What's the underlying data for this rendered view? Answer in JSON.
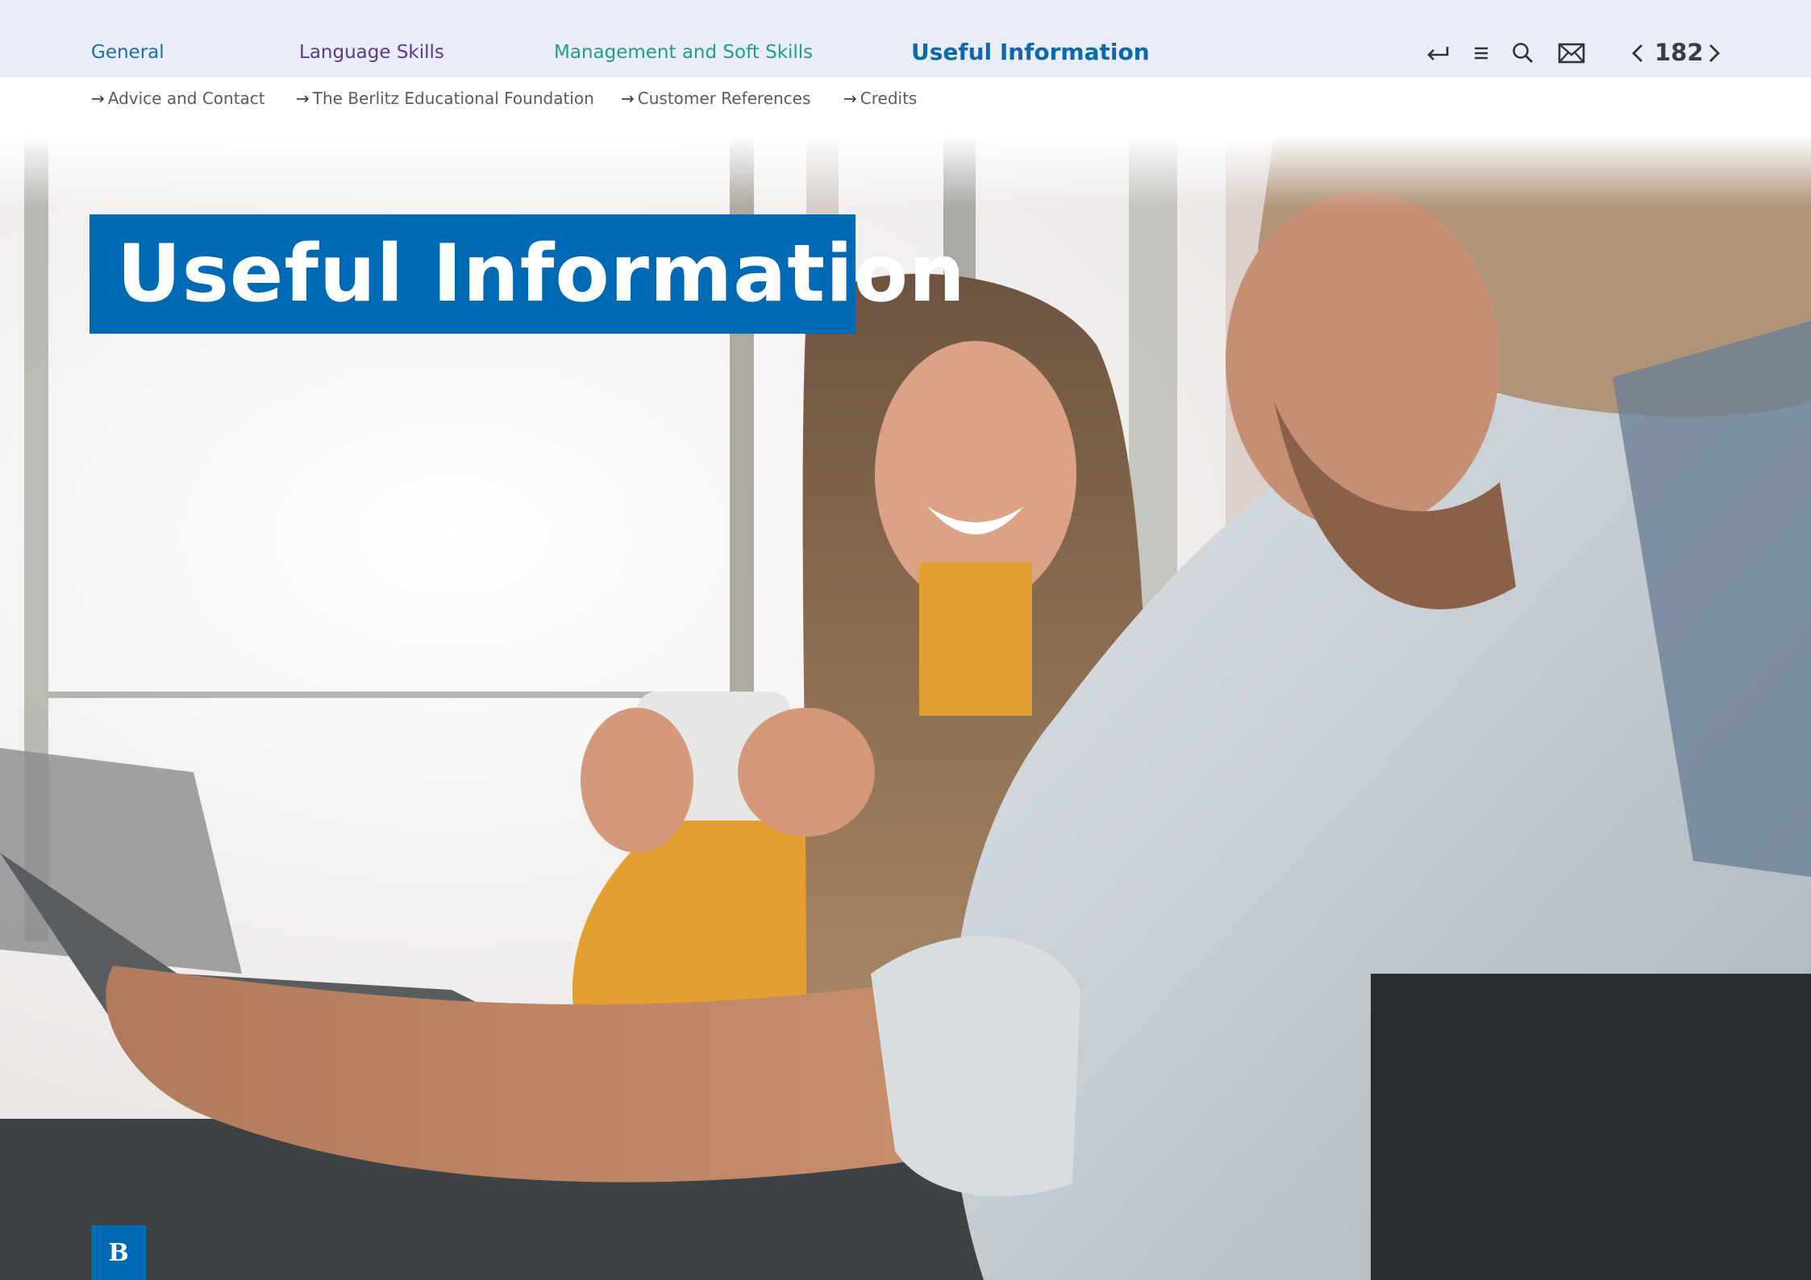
{
  "nav": {
    "tabs": [
      {
        "label": "General",
        "color": "#1a6ea8"
      },
      {
        "label": "Language Skills",
        "color": "#5b3a8c"
      },
      {
        "label": "Management and Soft Skills",
        "color": "#1f9e82"
      },
      {
        "label": "Useful Information",
        "color": "#0a68ad"
      }
    ],
    "active_tab": "Useful Information",
    "tools": [
      "return-icon",
      "menu-icon",
      "search-icon",
      "mail-icon"
    ],
    "page": {
      "number": "182"
    }
  },
  "subnav": {
    "arrow": "→",
    "items": [
      {
        "label": "Advice and Contact"
      },
      {
        "label": "The Berlitz Educational Foundation"
      },
      {
        "label": "Customer References"
      },
      {
        "label": "Credits"
      }
    ]
  },
  "hero": {
    "title": "Useful Information",
    "title_bg": "#0069b4"
  },
  "logo": {
    "letter": "B"
  }
}
